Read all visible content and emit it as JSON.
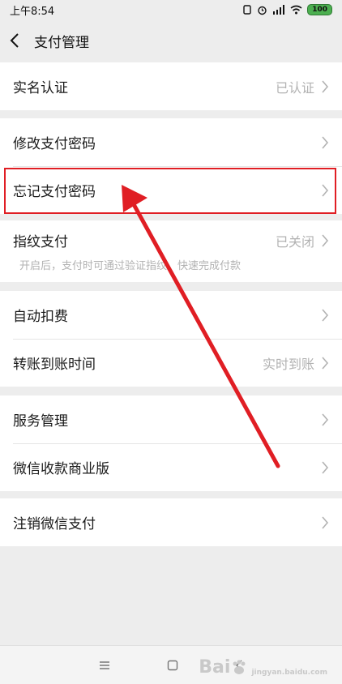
{
  "status": {
    "time": "上午8:54",
    "battery": "100"
  },
  "nav": {
    "title": "支付管理"
  },
  "sections": {
    "realname": {
      "label": "实名认证",
      "value": "已认证"
    },
    "password": [
      {
        "label": "修改支付密码"
      },
      {
        "label": "忘记支付密码"
      }
    ],
    "fingerprint": {
      "label": "指纹支付",
      "value": "已关闭",
      "desc": "开启后，支付时可通过验证指纹，快速完成付款"
    },
    "fees": [
      {
        "label": "自动扣费"
      },
      {
        "label": "转账到账时间",
        "value": "实时到账"
      }
    ],
    "services": [
      {
        "label": "服务管理"
      },
      {
        "label": "微信收款商业版"
      }
    ],
    "cancel": {
      "label": "注销微信支付"
    }
  },
  "watermark": {
    "brand": "Bai",
    "site": "jingyan.baidu.com"
  },
  "colors": {
    "accent": "#e01e24",
    "background": "#ededed"
  }
}
